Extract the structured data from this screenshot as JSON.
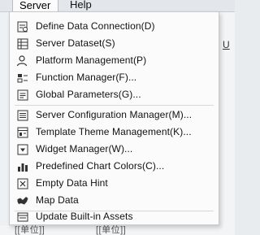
{
  "menubar": {
    "items": [
      {
        "label": "Server"
      },
      {
        "label": "Help"
      }
    ]
  },
  "background": {
    "right_glyph": "U",
    "bottom_left_text": "[[单位]]",
    "bottom_right_text": "[[单位]]"
  },
  "menu": {
    "items": [
      {
        "label": "Define Data Connection(D)",
        "icon": "data-connection-icon"
      },
      {
        "label": "Server Dataset(S)",
        "icon": "server-dataset-icon"
      },
      {
        "label": "Platform Management(P)",
        "icon": "platform-management-icon"
      },
      {
        "label": "Function Manager(F)...",
        "icon": "function-manager-icon"
      },
      {
        "label": "Global Parameters(G)...",
        "icon": "global-parameters-icon"
      },
      {
        "label": "Server Configuration Manager(M)...",
        "icon": "server-configuration-icon"
      },
      {
        "label": "Template Theme Management(K)...",
        "icon": "template-theme-icon"
      },
      {
        "label": "Widget Manager(W)...",
        "icon": "widget-manager-icon"
      },
      {
        "label": "Predefined Chart Colors(C)...",
        "icon": "chart-colors-icon"
      },
      {
        "label": "Empty Data Hint",
        "icon": "empty-data-hint-icon"
      },
      {
        "label": "Map Data",
        "icon": "map-data-icon"
      },
      {
        "label": "Update Built-in Assets",
        "icon": "update-assets-icon"
      }
    ]
  }
}
